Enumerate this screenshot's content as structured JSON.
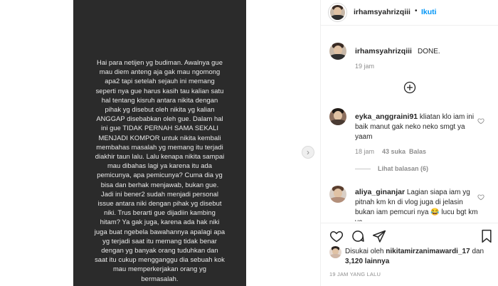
{
  "post": {
    "caption_body": "Hai para netijen yg budiman. Awalnya gue\nmau diem anteng aja gak mau ngomong\napa2 tapi setelah sejauh ini memang\nseperti nya gue harus kasih tau kalian satu\nhal tentang kisruh antara nikita dengan\npihak yg disebut oleh nikita yg kalian\nANGGAP disebabkan oleh gue. Dalam hal\nini gue TIDAK PERNAH SAMA SEKALI\nMENJADI KOMPOR untuk nikita kembali\nmembahas masalah yg memang itu terjadi\ndiakhir taun lalu. Lalu kenapa nikita sampai\nmau dibahas lagi ya karena itu ada\npemicunya, apa pemicunya? Cuma dia yg\nbisa dan berhak menjawab, bukan gue.\nJadi ini bener2 sudah menjadi personal\nissue antara niki dengan pihak yg disebut\nniki. Trus berarti gue dijadiin kambing\nhitam? Ya gak juga, karena ada hak niki\njuga buat ngebela bawahannya apalagi apa\nyg terjadi saat itu memang tidak benar\ndengan yg banyak orang tuduhkan dan\nsaat itu cukup mengganggu dia sebuah kok\nmau memperkerjakan orang yg\nbermasalah."
  },
  "header": {
    "username": "irhamsyahrizqiii",
    "separator": "•",
    "follow_label": "Ikuti"
  },
  "caption": {
    "username": "irhamsyahrizqiii",
    "text": "DONE.",
    "time": "19 jam"
  },
  "comments": [
    {
      "username": "eyka_anggraini91",
      "text": "kliatan klo iam ini baik manut gak neko neko smgt ya yaam",
      "time": "18 jam",
      "likes": "43 suka",
      "reply_label": "Balas",
      "view_replies": "Lihat balasan (6)"
    },
    {
      "username": "aliya_ginanjar",
      "text": "Lagian siapa iam yg pitnah km kn di vlog juga di jelasin bukan iam pemcuri nya 😂 lucu bgt km ya"
    }
  ],
  "footer": {
    "liked_by_prefix": "Disukai oleh",
    "liked_by_user": "nikitamirzanimawardi_17",
    "liked_by_and": "dan",
    "liked_by_count": "3,120 lainnya",
    "timestamp": "19 JAM YANG LALU"
  },
  "icons": {
    "next": "chevron-right-icon",
    "add": "plus-circle-icon",
    "like": "heart-icon",
    "comment": "comment-icon",
    "share": "paper-plane-icon",
    "save": "bookmark-icon"
  },
  "colors": {
    "accent": "#0095f6",
    "story_bg": "#2b2b2b",
    "text": "#262626",
    "muted": "#8e8e8e"
  }
}
